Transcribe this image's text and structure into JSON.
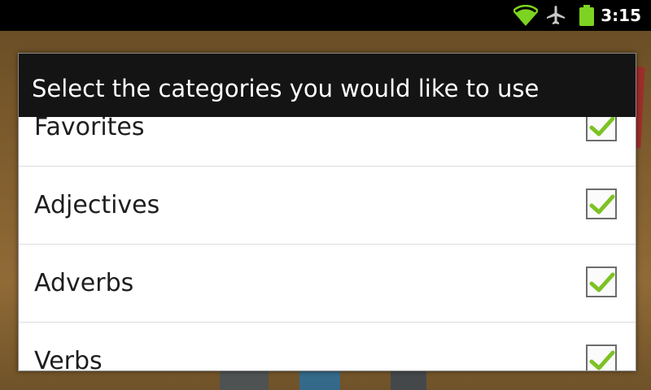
{
  "status_bar": {
    "time": "3:15",
    "icons": [
      "wifi-icon",
      "airplane-icon",
      "battery-icon"
    ]
  },
  "dialog": {
    "title": "Select the categories you would like to use",
    "items": [
      {
        "label": "Favorites",
        "checked": true
      },
      {
        "label": "Adjectives",
        "checked": true
      },
      {
        "label": "Adverbs",
        "checked": true
      },
      {
        "label": "Verbs",
        "checked": true
      }
    ]
  },
  "colors": {
    "title_bar": "#141414",
    "check_green": "#7dc225",
    "status_green": "#7dd321"
  }
}
